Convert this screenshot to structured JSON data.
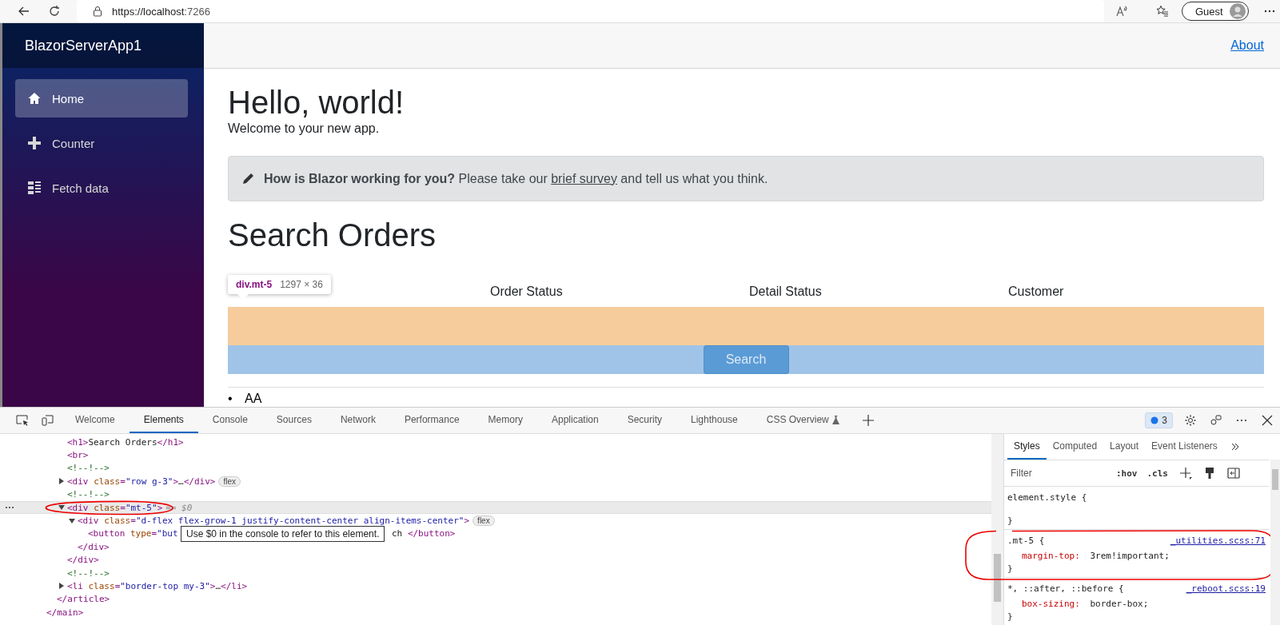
{
  "browser": {
    "url_host": "https://localhost",
    "url_port": ":7266",
    "profile": "Guest"
  },
  "app": {
    "brand": "BlazorServerApp1",
    "nav": [
      {
        "label": "Home",
        "selected": true
      },
      {
        "label": "Counter",
        "selected": false
      },
      {
        "label": "Fetch data",
        "selected": false
      }
    ],
    "top_link": "About",
    "title": "Hello, world!",
    "welcome": "Welcome to your new app.",
    "survey": {
      "before": "**How is Blazor working for you?** Please take our",
      "link": "brief survey",
      "after": "and tell us what you think."
    },
    "search_title": "Search Orders",
    "filter_labels": [
      "Order Status",
      "Detail Status",
      "Customer"
    ],
    "inspect_tooltip": {
      "selector": "div.mt-5",
      "size": "1297 × 36"
    },
    "search_button": "Search",
    "list_items": [
      {
        "marker": "•",
        "text": "AA"
      }
    ]
  },
  "devtools": {
    "tabs": [
      {
        "label": "Welcome",
        "selected": false
      },
      {
        "label": "Elements",
        "selected": true
      },
      {
        "label": "Console",
        "selected": false
      },
      {
        "label": "Sources",
        "selected": false
      },
      {
        "label": "Network",
        "selected": false
      },
      {
        "label": "Performance",
        "selected": false
      },
      {
        "label": "Memory",
        "selected": false
      },
      {
        "label": "Application",
        "selected": false
      },
      {
        "label": "Security",
        "selected": false
      },
      {
        "label": "Lighthouse",
        "selected": false
      },
      {
        "label": "CSS Overview",
        "selected": false
      }
    ],
    "issues_count": "3",
    "dom": [
      {
        "close": [
          {
            "kind": "tag",
            "text": "</main>"
          }
        ],
        "children": [
          {
            "close": [
              {
                "kind": "tag",
                "text": "</article>"
              }
            ],
            "children": [
              {
                "selected": false,
                "tokens": [
                  {
                    "kind": "tag",
                    "text": "<h1>"
                  },
                  {
                    "kind": "text",
                    "text": "Search Orders"
                  },
                  {
                    "kind": "tag",
                    "text": "</h1>"
                  }
                ]
              },
              {
                "selected": false,
                "tokens": [
                  {
                    "kind": "tag",
                    "text": "<br>"
                  }
                ]
              },
              {
                "selected": false,
                "tokens": [
                  {
                    "kind": "comment",
                    "text": "<!--!-->"
                  }
                ]
              },
              {
                "selected": false,
                "expanded": false,
                "badge": "flex",
                "tokens": [
                  {
                    "kind": "tag",
                    "text": "<div "
                  },
                  {
                    "kind": "attr",
                    "text": "class"
                  },
                  {
                    "kind": "tag",
                    "text": "="
                  },
                  {
                    "kind": "value",
                    "text": "\"row g-3\""
                  },
                  {
                    "kind": "tag",
                    "text": ">"
                  },
                  {
                    "kind": "text",
                    "text": "…"
                  },
                  {
                    "kind": "tag",
                    "text": "</div>"
                  }
                ]
              },
              {
                "selected": false,
                "tokens": [
                  {
                    "kind": "comment",
                    "text": "<!--!-->"
                  }
                ]
              },
              {
                "selected": true,
                "expanded": true,
                "note": "== $0",
                "tokens": [
                  {
                    "kind": "tag",
                    "text": "<div "
                  },
                  {
                    "kind": "attr",
                    "text": "class"
                  },
                  {
                    "kind": "tag",
                    "text": "="
                  },
                  {
                    "kind": "value",
                    "text": "\"mt-5\""
                  },
                  {
                    "kind": "tag",
                    "text": ">"
                  }
                ],
                "close": [
                  {
                    "kind": "tag",
                    "text": "</div>"
                  }
                ],
                "children": [
                  {
                    "selected": false,
                    "expanded": true,
                    "badge": "flex",
                    "tokens": [
                      {
                        "kind": "tag",
                        "text": "<div "
                      },
                      {
                        "kind": "attr",
                        "text": "class"
                      },
                      {
                        "kind": "tag",
                        "text": "="
                      },
                      {
                        "kind": "value",
                        "text": "\"d-flex flex-grow-1 justify-content-center align-items-center\""
                      },
                      {
                        "kind": "tag",
                        "text": ">"
                      }
                    ],
                    "close": [
                      {
                        "kind": "tag",
                        "text": "</div>"
                      }
                    ],
                    "children": [
                      {
                        "selected": false,
                        "tokens": [
                          {
                            "kind": "tag",
                            "text": "<button "
                          },
                          {
                            "kind": "attr",
                            "text": "type"
                          },
                          {
                            "kind": "tag",
                            "text": "="
                          },
                          {
                            "kind": "value",
                            "text": "\"but"
                          }
                        ],
                        "tooltip": "Use $0 in the console to refer to this element.",
                        "tokens_after": [
                          {
                            "kind": "text",
                            "text": "ch "
                          },
                          {
                            "kind": "tag",
                            "text": "</button>"
                          }
                        ]
                      }
                    ]
                  }
                ]
              },
              {
                "selected": false,
                "tokens": [
                  {
                    "kind": "comment",
                    "text": "<!--!-->"
                  }
                ]
              },
              {
                "selected": false,
                "expanded": false,
                "tokens": [
                  {
                    "kind": "tag",
                    "text": "<"
                  },
                  {
                    "kind": "tag",
                    "text": "li "
                  },
                  {
                    "kind": "attr",
                    "text": "class"
                  },
                  {
                    "kind": "tag",
                    "text": "="
                  },
                  {
                    "kind": "value",
                    "text": "\"border-top my-3\""
                  },
                  {
                    "kind": "tag",
                    "text": ">"
                  },
                  {
                    "kind": "text",
                    "text": "…"
                  },
                  {
                    "kind": "tag",
                    "text": "</li>"
                  }
                ]
              }
            ]
          }
        ]
      }
    ],
    "side_tabs": [
      {
        "label": "Styles",
        "selected": true
      },
      {
        "label": "Computed",
        "selected": false
      },
      {
        "label": "Layout",
        "selected": false
      },
      {
        "label": "Event Listeners",
        "selected": false
      }
    ],
    "filter_placeholder": "Filter",
    "hov": ":hov",
    "cls": ".cls",
    "rules": [
      {
        "header": "element.style {",
        "close": "}"
      },
      {
        "header": ".mt-5 {",
        "source": "_utilities.scss:71",
        "close": "}",
        "declarations": [
          {
            "property": "margin-top:",
            "value": "3rem!important;"
          }
        ]
      },
      {
        "header": "*, ::after, ::before {",
        "source": "_reboot.scss:19",
        "close": "}",
        "declarations": [
          {
            "property": "box-sizing:",
            "value": "border-box;"
          }
        ]
      }
    ]
  }
}
